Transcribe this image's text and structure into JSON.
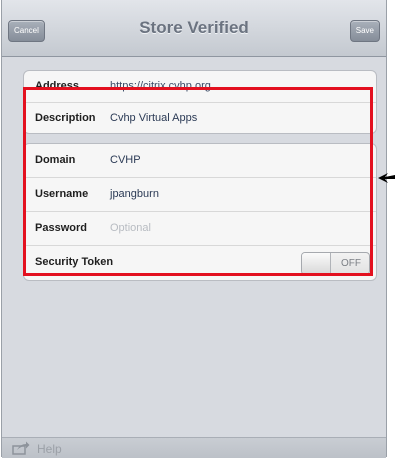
{
  "navbar": {
    "title": "Store Verified",
    "cancel_label": "Cancel",
    "save_label": "Save"
  },
  "group1": {
    "rows": [
      {
        "label": "Address",
        "value": "https://citrix.cvhp.org"
      },
      {
        "label": "Description",
        "value": "Cvhp Virtual Apps"
      }
    ]
  },
  "group2": {
    "rows": [
      {
        "label": "Domain",
        "value": "CVHP"
      },
      {
        "label": "Username",
        "value": "jpangburn"
      },
      {
        "label": "Password",
        "placeholder": "Optional"
      },
      {
        "label": "Security Token",
        "toggle": "OFF"
      }
    ]
  },
  "bottom": {
    "help_label": "Help",
    "icon": "share-icon"
  },
  "colors": {
    "highlight": "#e3101f",
    "navbar": "#c4c9d0"
  }
}
